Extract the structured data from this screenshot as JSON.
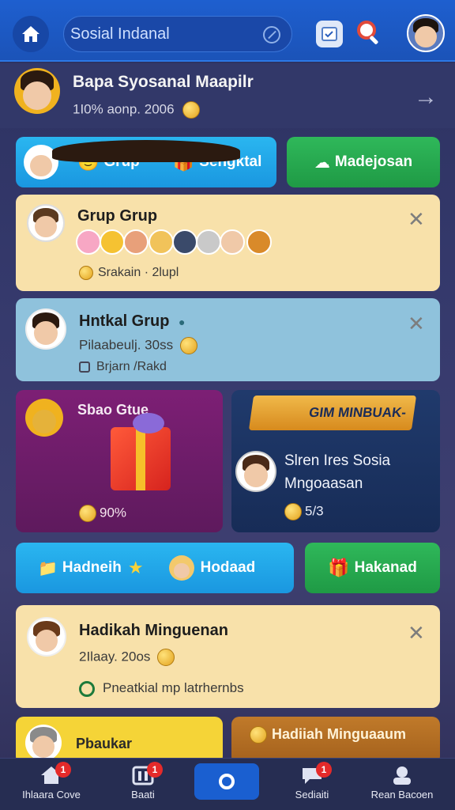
{
  "topbar": {
    "search_placeholder": "Sosial Indanal",
    "colors": {
      "bar": "#1e5fcf",
      "accent": "#2ab6f0"
    }
  },
  "header": {
    "title": "Bapa Syosanal Maapilr",
    "subtitle": "1I0% aonp. 2006"
  },
  "pills_top": [
    {
      "label": "Grup",
      "icon": "smiley-icon"
    },
    {
      "label": "Sehgktal",
      "icon": "gift-icon"
    },
    {
      "label": "Madejosan",
      "icon": "cloud-icon"
    }
  ],
  "card_grup": {
    "title": "Grup Grup",
    "footer": "Srakain · 2lupl"
  },
  "card_hotkal": {
    "title": "Hntkal Grup",
    "subtitle": "Pilaabeulj. 30ss",
    "footer": "Brjarn /Rakd"
  },
  "promo_left": {
    "title": "Sbao Gtue",
    "percent": "90%"
  },
  "promo_right": {
    "banner": "GIM MINBUAK-",
    "title_line1": "Slren Ires Sosia",
    "title_line2": "Mngoaasan",
    "count": "5/3"
  },
  "pills_mid": [
    {
      "label": "Hadneih"
    },
    {
      "label": "Hodaad"
    },
    {
      "label": "Hakanad"
    }
  ],
  "card_hadikah": {
    "title": "Hadikah Minguenan",
    "subtitle": "2Ilaay. 20os",
    "footer": "Pneatkial mp latrhernbs"
  },
  "peek_cards": {
    "left": "Pbaukar",
    "right": "Hadiiah Minguaaum"
  },
  "bottom_nav": [
    {
      "label": "Ihlaara Cove",
      "badge": "1"
    },
    {
      "label": "Baati",
      "badge": "1"
    },
    {
      "label": "",
      "badge": ""
    },
    {
      "label": "Sediaiti",
      "badge": "1"
    },
    {
      "label": "Rean Bacoen",
      "badge": ""
    }
  ]
}
